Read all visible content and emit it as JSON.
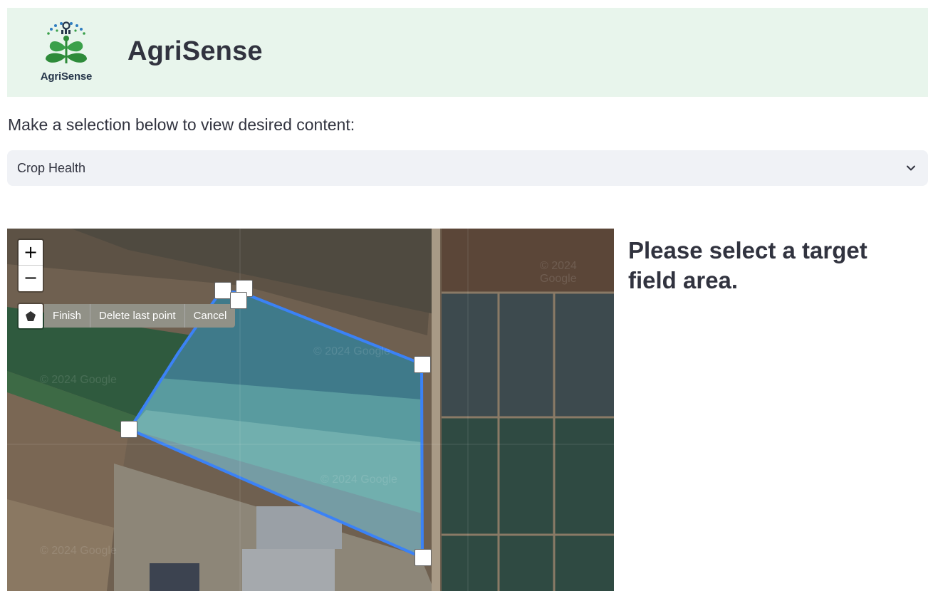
{
  "app": {
    "title": "AgriSense",
    "logo_text": "AgriSense",
    "logo_icon": "sprout-logo-icon"
  },
  "selector": {
    "prompt": "Make a selection below to view desired content:",
    "value": "Crop Health",
    "icon": "chevron-down-icon"
  },
  "map": {
    "zoom_in": "+",
    "zoom_out": "−",
    "draw_icon": "polygon-draw-icon",
    "actions": {
      "finish": "Finish",
      "delete_last": "Delete last point",
      "cancel": "Cancel"
    },
    "watermarks": [
      "© 2024 Google",
      "© 2024 Google",
      "© 2024 Google",
      "© 2024 Google",
      "© 2024 Google"
    ],
    "polygon_color": "#3b82f6"
  },
  "side": {
    "message": "Please select a target field area."
  },
  "colors": {
    "header_bg": "#e8f5ec",
    "select_bg": "#f0f2f6",
    "text": "#31333f",
    "logo_green": "#2e8b3a",
    "logo_navy": "#26364a"
  }
}
